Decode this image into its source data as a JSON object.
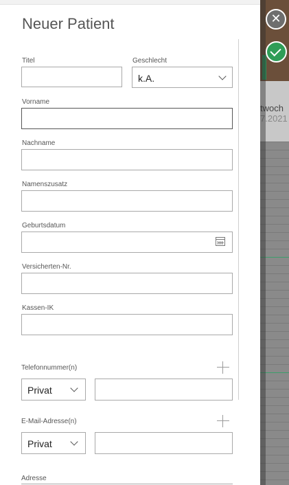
{
  "dialog": {
    "title": "Neuer Patient",
    "fields": {
      "titel": {
        "label": "Titel",
        "value": ""
      },
      "geschlecht": {
        "label": "Geschlecht",
        "value": "k.A."
      },
      "vorname": {
        "label": "Vorname",
        "value": ""
      },
      "nachname": {
        "label": "Nachname",
        "value": ""
      },
      "namenszusatz": {
        "label": "Namenszusatz",
        "value": ""
      },
      "geburtsdatum": {
        "label": "Geburtsdatum",
        "value": ""
      },
      "versichertennr": {
        "label": "Versicherten-Nr.",
        "value": ""
      },
      "kassenik": {
        "label": "Kassen-IK",
        "value": ""
      }
    },
    "telefon": {
      "label": "Telefonnummer(n)",
      "type": "Privat",
      "value": ""
    },
    "email": {
      "label": "E-Mail-Adresse(n)",
      "type": "Privat",
      "value": ""
    },
    "adresse": {
      "label": "Adresse"
    }
  },
  "background": {
    "weekday_fragment": "twoch",
    "date_fragment": "7.2021"
  },
  "colors": {
    "accent_green": "#2f9d57",
    "border": "#a8a8a8"
  },
  "icons": {
    "close": "close-icon",
    "confirm": "check-icon",
    "calendar": "calendar-icon",
    "add": "plus-icon",
    "dropdown": "chevron-down-icon"
  }
}
